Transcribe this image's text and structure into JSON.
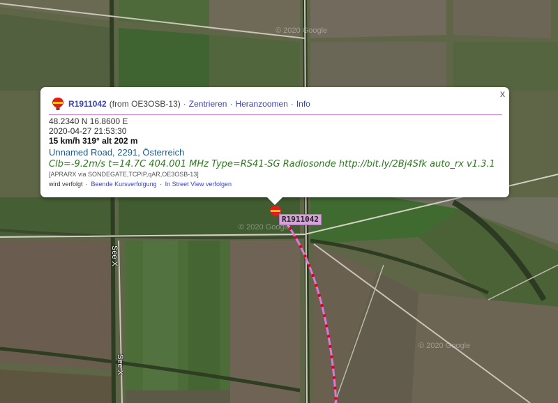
{
  "map": {
    "road_labels": [
      "See X",
      "See X"
    ],
    "watermarks": [
      "© 2020 Google",
      "© 2020 Google",
      "© 2020 Google"
    ],
    "track_color": "#d77ad8",
    "track_dot_color": "#e0001a"
  },
  "marker": {
    "label": "R1911042",
    "icon": "balloon-icon"
  },
  "popup": {
    "callsign": "R1911042",
    "from": "(from OE3OSB-13)",
    "links": [
      "Zentrieren",
      "Heranzoomen",
      "Info"
    ],
    "separator": "·",
    "close": "x",
    "coords": "48.2340 N 16.8600 E",
    "timestamp": "2020-04-27 21:53:30",
    "speed": "15 km/h 319° alt 202 m",
    "address": "Unnamed Road, 2291, Österreich",
    "comment": "Clb=-9.2m/s t=14.7C 404.001 MHz Type=RS41-SG Radiosonde http://bit.ly/2Bj4Sfk auto_rx v1.3.1",
    "path": "[APRARX via SONDEGATE,TCPIP,qAR,OE3OSB-13]",
    "tracking_status": "wird verfolgt",
    "tracking_links": [
      "Beende Kursverfolgung",
      "In Street View verfolgen"
    ]
  }
}
